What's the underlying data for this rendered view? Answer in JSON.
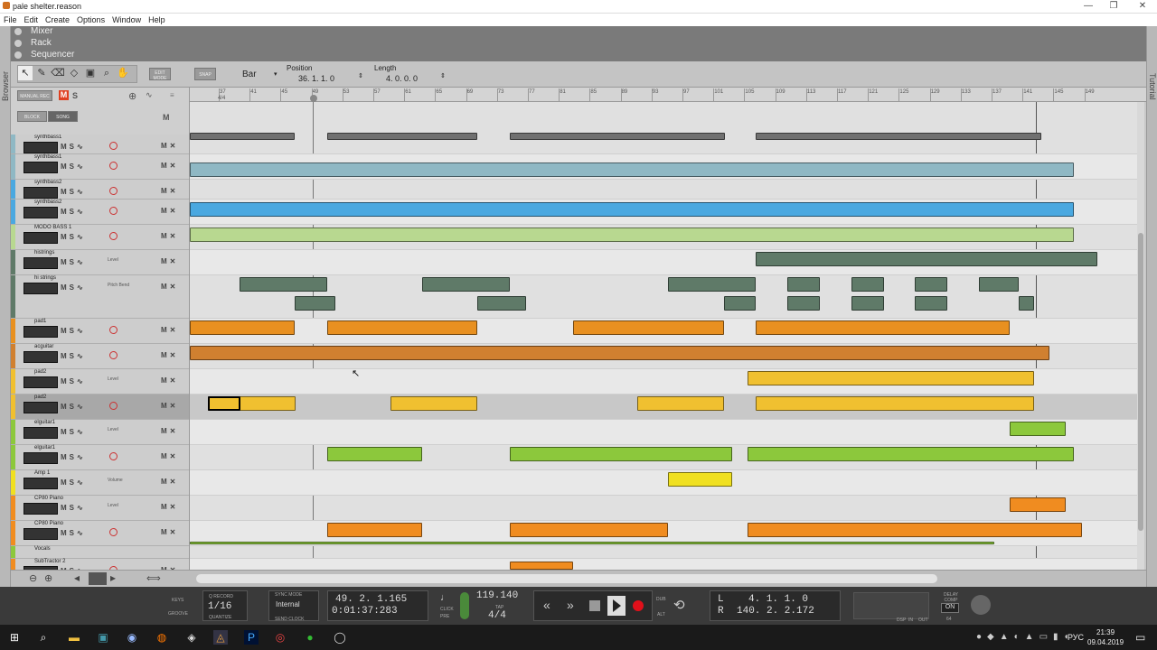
{
  "window": {
    "title": "pale shelter.reason",
    "controls": [
      "—",
      "❐",
      "✕"
    ]
  },
  "menu": [
    "File",
    "Edit",
    "Create",
    "Options",
    "Window",
    "Help"
  ],
  "side_tabs": {
    "left": "Browser",
    "right": "Tutorial"
  },
  "sections": [
    "Mixer",
    "Rack",
    "Sequencer"
  ],
  "toolbar": {
    "edit_mode_label": "EDIT MODE",
    "snap_label": "SNAP",
    "snap_value": "Bar",
    "position_label": "Position",
    "position_value": "36. 1. 1.   0",
    "length_label": "Length",
    "length_value": "4. 0. 0.   0"
  },
  "track_header": {
    "manual_rec": "MANUAL REC",
    "m": "M",
    "s": "S",
    "block": "BLOCK",
    "song": "SONG",
    "mcol": "M"
  },
  "ruler_ticks": [
    "37",
    "41",
    "45",
    "49",
    "53",
    "57",
    "61",
    "65",
    "69",
    "73",
    "77",
    "81",
    "85",
    "89",
    "93",
    "97",
    "101",
    "105",
    "109",
    "113",
    "117",
    "121",
    "125",
    "129",
    "133",
    "137",
    "141",
    "145",
    "149"
  ],
  "ruler_sub": "4/4",
  "tracks": [
    {
      "name": "synthbass1",
      "sub": "",
      "color": "#8fb8c4"
    },
    {
      "name": "synthbass1",
      "sub": "",
      "color": "#8fb8c4"
    },
    {
      "name": "synthbass2",
      "sub": "",
      "color": "#4aa8e0"
    },
    {
      "name": "synthbass2",
      "sub": "",
      "color": "#4aa8e0"
    },
    {
      "name": "MODO BASS 1",
      "sub": "",
      "color": "#b8d890"
    },
    {
      "name": "histrings",
      "sub": "Level",
      "color": "#5f7a68"
    },
    {
      "name": "hi strings",
      "sub": "Pitch Bend",
      "color": "#5f7a68"
    },
    {
      "name": "pad1",
      "sub": "",
      "color": "#e89020"
    },
    {
      "name": "acguitar",
      "sub": "",
      "color": "#d08030"
    },
    {
      "name": "pad2",
      "sub": "Level",
      "color": "#f0c030"
    },
    {
      "name": "pad2",
      "sub": "",
      "color": "#f0c030"
    },
    {
      "name": "elguitar1",
      "sub": "Level",
      "color": "#8cc83c"
    },
    {
      "name": "elguitar1",
      "sub": "",
      "color": "#8cc83c"
    },
    {
      "name": "Amp 1",
      "sub": "Volume",
      "color": "#f0e020"
    },
    {
      "name": "CP80 Piano",
      "sub": "Level",
      "color": "#f08c20"
    },
    {
      "name": "CP80 Piano",
      "sub": "",
      "color": "#f08c20"
    },
    {
      "name": "Vocals",
      "sub": "",
      "color": "#8cc83c"
    },
    {
      "name": "SubTractor 2",
      "sub": "",
      "color": "#f08c20"
    }
  ],
  "transport": {
    "keys": "KEYS",
    "groove": "GROOVE",
    "q_record": "Q RECORD",
    "quantize_value": "1/16",
    "quantize": "QUANTIZE",
    "sync_mode": "SYNC MODE",
    "sync_value": "Internal",
    "send_clock": "SEND CLOCK",
    "bars": "49.  2.  1.165",
    "time": "0:01:37:283",
    "click": "CLICK",
    "pre": "PRE",
    "tempo": "119.140",
    "tap": "TAP",
    "signature": "4/4",
    "dub": "DUB",
    "alt": "ALT",
    "loop_l_label": "L",
    "loop_l": "4.  1.  1.    0",
    "loop_r_label": "R",
    "loop_r": "140.  2.  2.172",
    "dsp": "DSP",
    "in": "IN",
    "out": "OUT",
    "delay_comp": "DELAY COMP",
    "on": "ON",
    "delay_val": "64"
  },
  "tray": {
    "lang": "РУС",
    "time": "21:39",
    "date": "09.04.2019"
  }
}
